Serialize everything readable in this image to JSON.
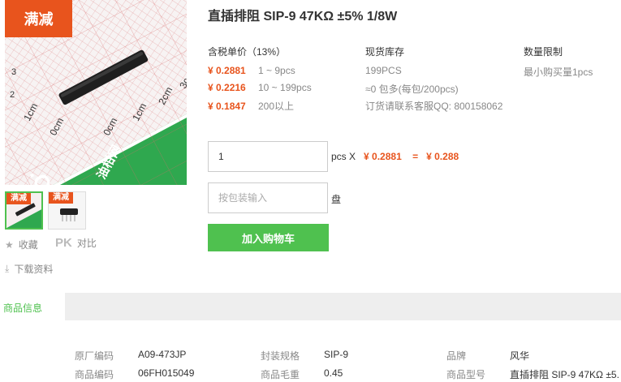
{
  "product": {
    "title": "直插排阻 SIP-9 47KΩ ±5% 1/8W",
    "promo_tag": "满减",
    "image_texts": {
      "logo": "油柑网",
      "domain_fragment": ".COM",
      "cm_left_1": "1cm",
      "cm_left_0": "0cm",
      "cm_right_0": "0cm",
      "cm_right_1": "1cm",
      "cm_right_2": "2cm",
      "cm_right_3": "3c",
      "cm_left_3": "3",
      "cm_left_2": "2"
    }
  },
  "thumbs": [
    {
      "tag": "满减"
    },
    {
      "tag": "满减"
    }
  ],
  "actions": {
    "favorite": "收藏",
    "pk": "PK",
    "compare": "对比",
    "download": "下载资料"
  },
  "pricing": {
    "header": "含税单价（13%）",
    "tiers": [
      {
        "price": "¥ 0.2881",
        "qty": "1 ~ 9pcs"
      },
      {
        "price": "¥ 0.2216",
        "qty": "10 ~ 199pcs"
      },
      {
        "price": "¥ 0.1847",
        "qty": "200以上"
      }
    ]
  },
  "stock": {
    "header": "现货库存",
    "lines": [
      "199PCS",
      "≈0 包多(每包/200pcs)",
      "订货请联系客服QQ: 800158062"
    ]
  },
  "limit": {
    "header": "数量限制",
    "text": "最小购买量1pcs"
  },
  "order": {
    "qty_value": "1",
    "pcs_x": "pcs X",
    "unit_price": "¥ 0.2881",
    "equals": "=",
    "total": "¥ 0.288",
    "pack_placeholder": "按包装输入",
    "pack_unit": "盘",
    "add_to_cart": "加入购物车"
  },
  "tabs": {
    "active": "商品信息"
  },
  "info": {
    "rows": [
      [
        {
          "k": "原厂编码",
          "v": "A09-473JP"
        },
        {
          "k": "封装规格",
          "v": "SIP-9"
        },
        {
          "k": "品牌",
          "v": "风华"
        }
      ],
      [
        {
          "k": "商品编码",
          "v": "06FH015049"
        },
        {
          "k": "商品毛重",
          "v": "0.45"
        },
        {
          "k": "商品型号",
          "v": "直插排阻 SIP-9 47KΩ ±5."
        }
      ]
    ]
  },
  "colors": {
    "accent_green": "#4fc14f",
    "price_red": "#e8541d"
  }
}
